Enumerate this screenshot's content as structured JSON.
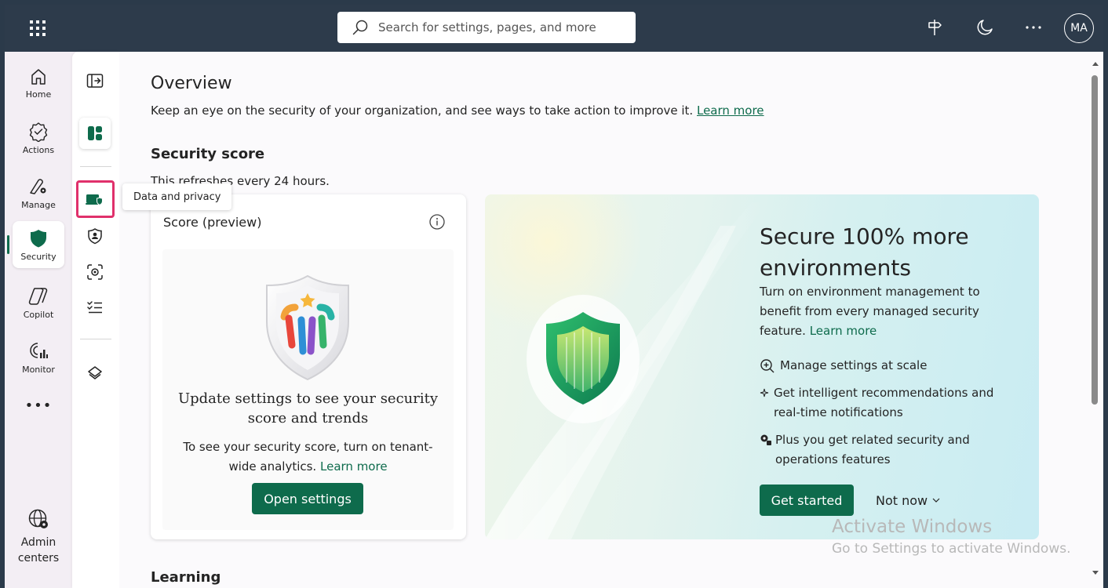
{
  "topbar": {
    "search_placeholder": "Search for settings, pages, and more",
    "avatar_initials": "MA"
  },
  "rail": {
    "items": [
      {
        "label": "Home",
        "icon": "home-icon"
      },
      {
        "label": "Actions",
        "icon": "actions-icon"
      },
      {
        "label": "Manage",
        "icon": "manage-icon"
      },
      {
        "label": "Security",
        "icon": "shield-icon"
      },
      {
        "label": "Copilot",
        "icon": "copilot-icon"
      },
      {
        "label": "Monitor",
        "icon": "monitor-icon"
      }
    ],
    "more": "•••",
    "admin_line1": "Admin",
    "admin_line2": "centers"
  },
  "subnav": {
    "tooltip": "Data and privacy"
  },
  "overview": {
    "title": "Overview",
    "description": "Keep an eye on the security of your organization, and see ways to take action to improve it.",
    "learn_more": "Learn more"
  },
  "security_score": {
    "title": "Security score",
    "refresh": "This refreshes every 24 hours.",
    "card_title": "Score (preview)",
    "update_heading": "Update settings to see your security score and trends",
    "update_text": "To see your security score, turn on tenant-wide analytics.",
    "learn_more": "Learn more",
    "open_button": "Open settings"
  },
  "promo": {
    "heading": "Secure 100% more environments",
    "text": "Turn on environment management to benefit from every managed security feature.",
    "learn_more": "Learn more",
    "features": [
      "Manage settings at scale",
      "Get intelligent recommendations and real-time notifications",
      "Plus you get related security and operations features"
    ],
    "get_started": "Get started",
    "not_now": "Not now"
  },
  "learning": {
    "title": "Learning"
  },
  "watermark": {
    "line1": "Activate Windows",
    "line2": "Go to Settings to activate Windows."
  },
  "colors": {
    "accent": "#0e6b4c",
    "topbar": "#2d3b4b",
    "highlight": "#e0306b"
  }
}
